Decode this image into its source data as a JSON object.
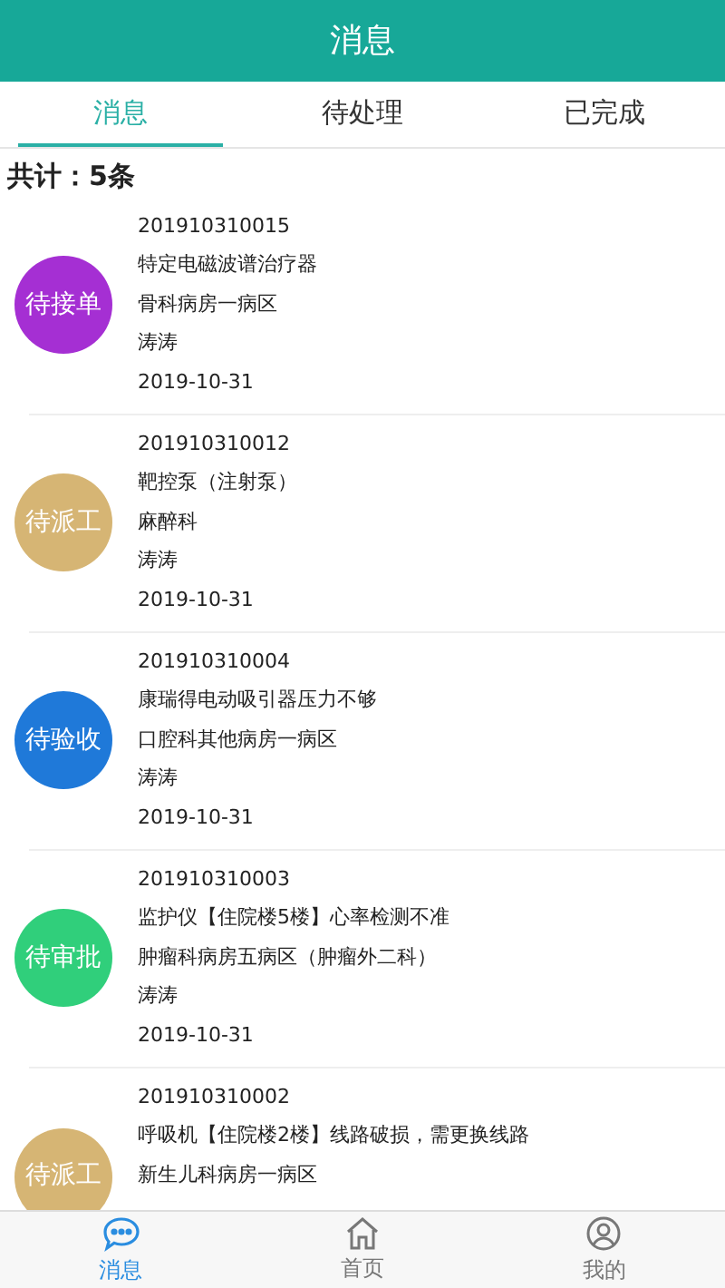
{
  "header": {
    "title": "消息"
  },
  "tabs": [
    {
      "label": "消息",
      "selected": true
    },
    {
      "label": "待处理",
      "selected": false
    },
    {
      "label": "已完成",
      "selected": false
    }
  ],
  "total": "共计：5条",
  "orders": [
    {
      "status": "待接单",
      "color": "#a52fd3",
      "number": "201910310015",
      "device": "特定电磁波谱治疗器",
      "department": "骨科病房一病区",
      "person": "涛涛",
      "date": "2019-10-31"
    },
    {
      "status": "待派工",
      "color": "#d6b574",
      "number": "201910310012",
      "device": "靶控泵（注射泵）",
      "department": "麻醉科",
      "person": "涛涛",
      "date": "2019-10-31"
    },
    {
      "status": "待验收",
      "color": "#1f79d9",
      "number": "201910310004",
      "device": "康瑞得电动吸引器压力不够",
      "department": "口腔科其他病房一病区",
      "person": "涛涛",
      "date": "2019-10-31"
    },
    {
      "status": "待审批",
      "color": "#30cf7b",
      "number": "201910310003",
      "device": "监护仪【住院楼5楼】心率检测不准",
      "department": "肿瘤科病房五病区（肿瘤外二科）",
      "person": "涛涛",
      "date": "2019-10-31"
    },
    {
      "status": "待派工",
      "color": "#d6b574",
      "number": "201910310002",
      "device": "呼吸机【住院楼2楼】线路破损，需更换线路",
      "department": "新生儿科病房一病区"
    }
  ],
  "nav": [
    {
      "kind": "chat",
      "label": "消息",
      "selected": true
    },
    {
      "kind": "home",
      "label": "首页",
      "selected": false
    },
    {
      "kind": "profile",
      "label": "我的",
      "selected": false
    }
  ]
}
